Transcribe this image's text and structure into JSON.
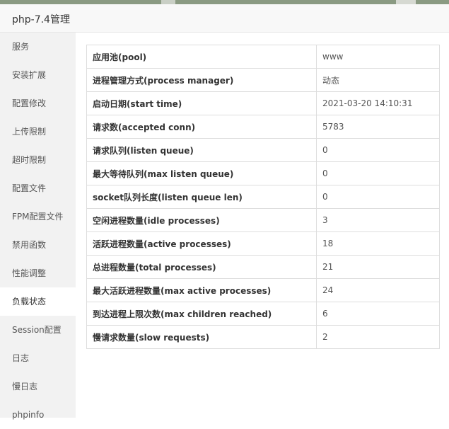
{
  "window": {
    "title": "php-7.4管理"
  },
  "sidebar": {
    "items": [
      {
        "label": "服务"
      },
      {
        "label": "安装扩展"
      },
      {
        "label": "配置修改"
      },
      {
        "label": "上传限制"
      },
      {
        "label": "超时限制"
      },
      {
        "label": "配置文件"
      },
      {
        "label": "FPM配置文件"
      },
      {
        "label": "禁用函数"
      },
      {
        "label": "性能调整"
      },
      {
        "label": "负载状态"
      },
      {
        "label": "Session配置"
      },
      {
        "label": "日志"
      },
      {
        "label": "慢日志"
      },
      {
        "label": "phpinfo"
      }
    ],
    "active_index": 9
  },
  "status": {
    "rows": [
      {
        "key": "应用池(pool)",
        "value": "www"
      },
      {
        "key": "进程管理方式(process manager)",
        "value": "动态"
      },
      {
        "key": "启动日期(start time)",
        "value": "2021-03-20 14:10:31"
      },
      {
        "key": "请求数(accepted conn)",
        "value": "5783"
      },
      {
        "key": "请求队列(listen queue)",
        "value": "0"
      },
      {
        "key": "最大等待队列(max listen queue)",
        "value": "0"
      },
      {
        "key": "socket队列长度(listen queue len)",
        "value": "0"
      },
      {
        "key": "空闲进程数量(idle processes)",
        "value": "3"
      },
      {
        "key": "活跃进程数量(active processes)",
        "value": "18"
      },
      {
        "key": "总进程数量(total processes)",
        "value": "21"
      },
      {
        "key": "最大活跃进程数量(max active processes)",
        "value": "24"
      },
      {
        "key": "到达进程上限次数(max children reached)",
        "value": "6"
      },
      {
        "key": "慢请求数量(slow requests)",
        "value": "2"
      }
    ]
  }
}
